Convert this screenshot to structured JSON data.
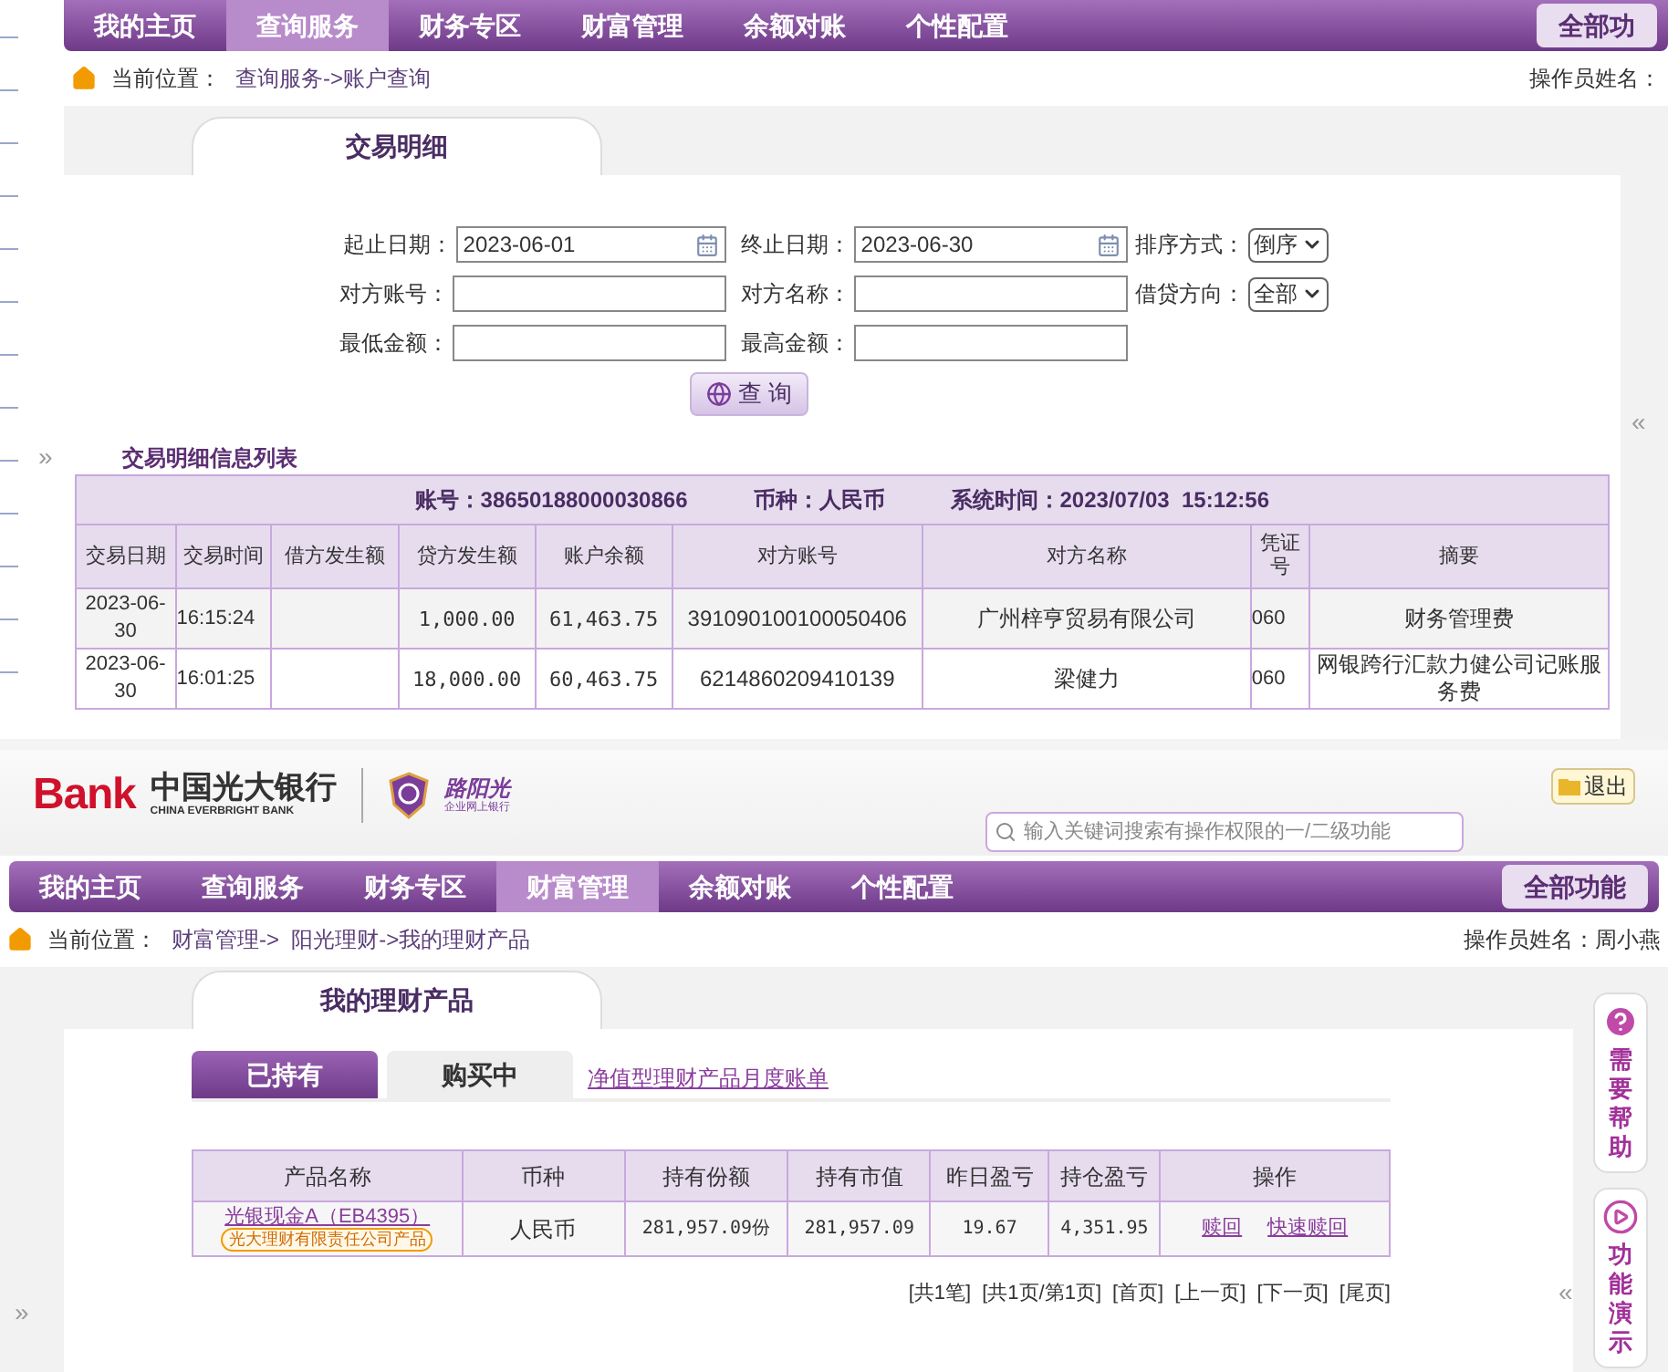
{
  "top": {
    "nav": {
      "items": [
        {
          "label": "我的主页",
          "selected": false
        },
        {
          "label": "查询服务",
          "selected": true
        },
        {
          "label": "财务专区",
          "selected": false
        },
        {
          "label": "财富管理",
          "selected": false
        },
        {
          "label": "余额对账",
          "selected": false
        },
        {
          "label": "个性配置",
          "selected": false
        }
      ],
      "all_button": "全部功"
    },
    "breadcrumb": {
      "label": "当前位置：",
      "path": "查询服务->账户查询"
    },
    "operator": "操作员姓名：",
    "tab": "交易明细",
    "expand_left": "»",
    "expand_right": "«",
    "form": [
      {
        "kind": "date",
        "label": "起止日期：",
        "value": "2023-06-01"
      },
      {
        "kind": "date",
        "label": "终止日期：",
        "value": "2023-06-30"
      },
      {
        "kind": "select",
        "label": "排序方式：",
        "value": "倒序"
      },
      {
        "kind": "text",
        "label": "对方账号："
      },
      {
        "kind": "text",
        "label": "对方名称："
      },
      {
        "kind": "select",
        "label": "借贷方向：",
        "value": "全部"
      },
      {
        "kind": "text",
        "label": "最低金额："
      },
      {
        "kind": "text",
        "label": "最高金额："
      }
    ],
    "query_button": "查 询",
    "list_title": "交易明细信息列表",
    "summary": [
      "账号：38650188000030866",
      "币种：人民币",
      "系统时间：2023/07/03  15:12:56"
    ],
    "table": {
      "columns": [
        "交易日期",
        "交易时间",
        "借方发生额",
        "贷方发生额",
        "账户余额",
        "对方账号",
        "对方名称",
        "凭证号",
        "摘要"
      ],
      "rows": [
        [
          "2023-06-30",
          "16:15:24",
          "",
          "1,000.00",
          "61,463.75",
          "391090100100050406",
          "广州梓亨贸易有限公司",
          "060",
          "财务管理费"
        ],
        [
          "2023-06-30",
          "16:01:25",
          "",
          "18,000.00",
          "60,463.75",
          "6214860209410139",
          "梁健力",
          "060",
          "网银跨行汇款力健公司记账服务费"
        ]
      ]
    }
  },
  "bottom": {
    "logo": {
      "mark": "Bank",
      "name": "中国光大银行",
      "name_en": "CHINA EVERBRIGHT BANK",
      "brand": "路阳光",
      "brand_sub": "企业网上银行"
    },
    "logout": "退出",
    "search": {
      "placeholder": "输入关键词搜索有操作权限的一/二级功能"
    },
    "nav": {
      "items": [
        {
          "label": "我的主页",
          "selected": false
        },
        {
          "label": "查询服务",
          "selected": false
        },
        {
          "label": "财务专区",
          "selected": false
        },
        {
          "label": "财富管理",
          "selected": true
        },
        {
          "label": "余额对账",
          "selected": false
        },
        {
          "label": "个性配置",
          "selected": false
        }
      ],
      "all_button": "全部功能"
    },
    "breadcrumb": {
      "label": "当前位置：",
      "path": "财富管理->  阳光理财->我的理财产品"
    },
    "operator": "操作员姓名：周小燕",
    "tab": "我的理财产品",
    "subtabs": [
      {
        "label": "已持有",
        "selected": true
      },
      {
        "label": "购买中",
        "selected": false
      }
    ],
    "statement_link": "净值型理财产品月度账单",
    "table": {
      "columns": [
        "产品名称",
        "币种",
        "持有份额",
        "持有市值",
        "昨日盈亏",
        "持仓盈亏",
        "操作"
      ],
      "rows": [
        {
          "name": "光银现金A（EB4395）",
          "issuer": "光大理财有限责任公司产品",
          "currency": "人民币",
          "shares": "281,957.09份",
          "value": "281,957.09",
          "yesterday": "19.67",
          "total": "4,351.95",
          "actions": [
            "赎回",
            "快速赎回"
          ]
        }
      ]
    },
    "pagination": [
      "[共1笔]",
      "[共1页/第1页]",
      "[首页]",
      "[上一页]",
      "[下一页]",
      "[尾页]"
    ],
    "expand_left": "»",
    "expand_right": "«",
    "side": [
      {
        "kind": "help",
        "label": "需要帮助"
      },
      {
        "kind": "demo",
        "label": "功能演示"
      }
    ]
  }
}
